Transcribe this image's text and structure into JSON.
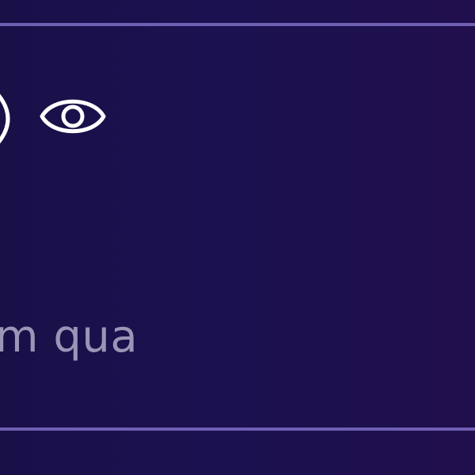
{
  "window": {
    "header_area": {
      "icons": [
        "right-parenthesis",
        "eye-icon"
      ]
    },
    "text_fragment": "m qua",
    "colors": {
      "background_left": "#1a1048",
      "background_right": "#200f4c",
      "divider": "#6f5fb3",
      "icon": "#ffffff",
      "text": "#9b95b6"
    }
  }
}
